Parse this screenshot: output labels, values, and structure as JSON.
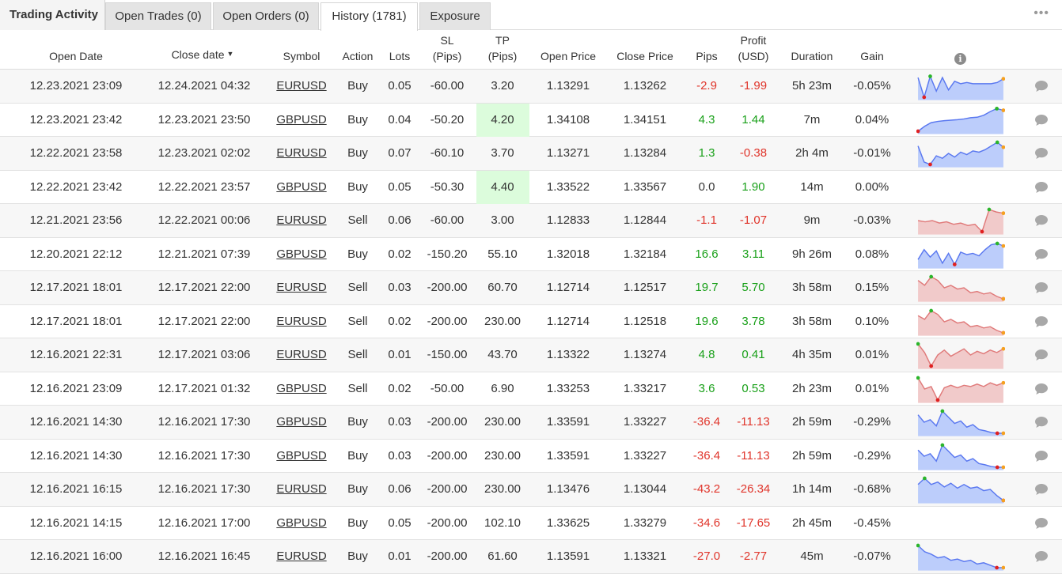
{
  "tabs": [
    {
      "label": "Trading Activity"
    },
    {
      "label": "Open Trades (0)"
    },
    {
      "label": "Open Orders (0)"
    },
    {
      "label": "History (1781)"
    },
    {
      "label": "Exposure"
    }
  ],
  "menu_icon": "more-dots-icon",
  "columns": {
    "open_date": "Open Date",
    "close_date": "Close date",
    "symbol": "Symbol",
    "action": "Action",
    "lots": "Lots",
    "sl": "SL",
    "sl_unit": "(Pips)",
    "tp": "TP",
    "tp_unit": "(Pips)",
    "open_price": "Open Price",
    "close_price": "Close Price",
    "pips": "Pips",
    "profit": "Profit",
    "profit_unit": "(USD)",
    "duration": "Duration",
    "gain": "Gain",
    "info": "i"
  },
  "colors": {
    "negative": "#e0352b",
    "positive": "#19a019",
    "tp_highlight": "#dcfcdc",
    "spark_buy": "#bccdfb",
    "spark_sell": "#f1caca"
  },
  "rows": [
    {
      "open": "12.23.2021 23:09",
      "close": "12.24.2021 04:32",
      "symbol": "EURUSD",
      "action": "Buy",
      "lots": "0.05",
      "sl": "-60.00",
      "tp": "3.20",
      "open_price": "1.13291",
      "close_price": "1.13262",
      "pips": "-2.9",
      "profit": "-1.99",
      "duration": "5h 23m",
      "gain": "-0.05%",
      "tp_hit": false,
      "spark": [
        0.85,
        0.05,
        0.9,
        0.3,
        0.85,
        0.35,
        0.7,
        0.6,
        0.65,
        0.6,
        0.6,
        0.6,
        0.6,
        0.65,
        0.8
      ]
    },
    {
      "open": "12.23.2021 23:42",
      "close": "12.23.2021 23:50",
      "symbol": "GBPUSD",
      "action": "Buy",
      "lots": "0.04",
      "sl": "-50.20",
      "tp": "4.20",
      "open_price": "1.34108",
      "close_price": "1.34151",
      "pips": "4.3",
      "profit": "1.44",
      "duration": "7m",
      "gain": "0.04%",
      "tp_hit": true,
      "spark": [
        0.05,
        0.25,
        0.4,
        0.45,
        0.48,
        0.5,
        0.52,
        0.55,
        0.6,
        0.62,
        0.7,
        0.85,
        0.97,
        0.9
      ]
    },
    {
      "open": "12.22.2021 23:58",
      "close": "12.23.2021 02:02",
      "symbol": "EURUSD",
      "action": "Buy",
      "lots": "0.07",
      "sl": "-60.10",
      "tp": "3.70",
      "open_price": "1.13271",
      "close_price": "1.13284",
      "pips": "1.3",
      "profit": "-0.38",
      "duration": "2h 4m",
      "gain": "-0.01%",
      "tp_hit": false,
      "spark": [
        0.8,
        0.15,
        0.05,
        0.4,
        0.3,
        0.5,
        0.35,
        0.55,
        0.45,
        0.6,
        0.55,
        0.65,
        0.8,
        0.95,
        0.75
      ]
    },
    {
      "open": "12.22.2021 23:42",
      "close": "12.22.2021 23:57",
      "symbol": "GBPUSD",
      "action": "Buy",
      "lots": "0.05",
      "sl": "-50.30",
      "tp": "4.40",
      "open_price": "1.33522",
      "close_price": "1.33567",
      "pips": "0.0",
      "profit": "1.90",
      "duration": "14m",
      "gain": "0.00%",
      "tp_hit": true,
      "spark": null
    },
    {
      "open": "12.21.2021 23:56",
      "close": "12.22.2021 00:06",
      "symbol": "EURUSD",
      "action": "Sell",
      "lots": "0.06",
      "sl": "-60.00",
      "tp": "3.00",
      "open_price": "1.12833",
      "close_price": "1.12844",
      "pips": "-1.1",
      "profit": "-1.07",
      "duration": "9m",
      "gain": "-0.03%",
      "tp_hit": false,
      "spark": [
        0.5,
        0.45,
        0.5,
        0.4,
        0.45,
        0.35,
        0.4,
        0.3,
        0.35,
        0.05,
        0.95,
        0.85,
        0.8
      ]
    },
    {
      "open": "12.20.2021 22:12",
      "close": "12.21.2021 07:39",
      "symbol": "GBPUSD",
      "action": "Buy",
      "lots": "0.02",
      "sl": "-150.20",
      "tp": "55.10",
      "open_price": "1.32018",
      "close_price": "1.32184",
      "pips": "16.6",
      "profit": "3.11",
      "duration": "9h 26m",
      "gain": "0.08%",
      "tp_hit": false,
      "spark": [
        0.3,
        0.7,
        0.4,
        0.65,
        0.15,
        0.55,
        0.1,
        0.6,
        0.5,
        0.55,
        0.45,
        0.7,
        0.9,
        0.95,
        0.85
      ]
    },
    {
      "open": "12.17.2021 18:01",
      "close": "12.17.2021 22:00",
      "symbol": "EURUSD",
      "action": "Sell",
      "lots": "0.03",
      "sl": "-200.00",
      "tp": "60.70",
      "open_price": "1.12714",
      "close_price": "1.12517",
      "pips": "19.7",
      "profit": "5.70",
      "duration": "3h 58m",
      "gain": "0.15%",
      "tp_hit": false,
      "spark": [
        0.8,
        0.6,
        0.95,
        0.8,
        0.5,
        0.6,
        0.45,
        0.5,
        0.3,
        0.35,
        0.25,
        0.3,
        0.15,
        0.05
      ]
    },
    {
      "open": "12.17.2021 18:01",
      "close": "12.17.2021 22:00",
      "symbol": "EURUSD",
      "action": "Sell",
      "lots": "0.02",
      "sl": "-200.00",
      "tp": "230.00",
      "open_price": "1.12714",
      "close_price": "1.12518",
      "pips": "19.6",
      "profit": "3.78",
      "duration": "3h 58m",
      "gain": "0.10%",
      "tp_hit": false,
      "spark": [
        0.75,
        0.6,
        0.95,
        0.8,
        0.5,
        0.6,
        0.45,
        0.5,
        0.3,
        0.35,
        0.25,
        0.3,
        0.15,
        0.05
      ]
    },
    {
      "open": "12.16.2021 22:31",
      "close": "12.17.2021 03:06",
      "symbol": "EURUSD",
      "action": "Sell",
      "lots": "0.01",
      "sl": "-150.00",
      "tp": "43.70",
      "open_price": "1.13322",
      "close_price": "1.13274",
      "pips": "4.8",
      "profit": "0.41",
      "duration": "4h 35m",
      "gain": "0.01%",
      "tp_hit": false,
      "spark": [
        0.95,
        0.6,
        0.05,
        0.5,
        0.7,
        0.45,
        0.6,
        0.75,
        0.5,
        0.65,
        0.55,
        0.7,
        0.6,
        0.75
      ]
    },
    {
      "open": "12.16.2021 23:09",
      "close": "12.17.2021 01:32",
      "symbol": "GBPUSD",
      "action": "Sell",
      "lots": "0.02",
      "sl": "-50.00",
      "tp": "6.90",
      "open_price": "1.33253",
      "close_price": "1.33217",
      "pips": "3.6",
      "profit": "0.53",
      "duration": "2h 23m",
      "gain": "0.01%",
      "tp_hit": false,
      "spark": [
        0.95,
        0.5,
        0.6,
        0.05,
        0.55,
        0.65,
        0.55,
        0.65,
        0.6,
        0.7,
        0.6,
        0.75,
        0.65,
        0.75
      ]
    },
    {
      "open": "12.16.2021 14:30",
      "close": "12.16.2021 17:30",
      "symbol": "GBPUSD",
      "action": "Buy",
      "lots": "0.03",
      "sl": "-200.00",
      "tp": "230.00",
      "open_price": "1.33591",
      "close_price": "1.33227",
      "pips": "-36.4",
      "profit": "-11.13",
      "duration": "2h 59m",
      "gain": "-0.29%",
      "tp_hit": false,
      "spark": [
        0.8,
        0.5,
        0.6,
        0.35,
        0.95,
        0.7,
        0.45,
        0.55,
        0.3,
        0.4,
        0.2,
        0.15,
        0.08,
        0.05,
        0.05
      ]
    },
    {
      "open": "12.16.2021 14:30",
      "close": "12.16.2021 17:30",
      "symbol": "GBPUSD",
      "action": "Buy",
      "lots": "0.03",
      "sl": "-200.00",
      "tp": "230.00",
      "open_price": "1.33591",
      "close_price": "1.33227",
      "pips": "-36.4",
      "profit": "-11.13",
      "duration": "2h 59m",
      "gain": "-0.29%",
      "tp_hit": false,
      "spark": [
        0.75,
        0.5,
        0.6,
        0.3,
        0.95,
        0.7,
        0.45,
        0.55,
        0.3,
        0.4,
        0.2,
        0.15,
        0.08,
        0.05,
        0.05
      ]
    },
    {
      "open": "12.16.2021 16:15",
      "close": "12.16.2021 17:30",
      "symbol": "EURUSD",
      "action": "Buy",
      "lots": "0.06",
      "sl": "-200.00",
      "tp": "230.00",
      "open_price": "1.13476",
      "close_price": "1.13044",
      "pips": "-43.2",
      "profit": "-26.34",
      "duration": "1h 14m",
      "gain": "-0.68%",
      "tp_hit": false,
      "spark": [
        0.7,
        0.95,
        0.7,
        0.8,
        0.6,
        0.75,
        0.55,
        0.7,
        0.55,
        0.6,
        0.45,
        0.5,
        0.25,
        0.05
      ]
    },
    {
      "open": "12.16.2021 14:15",
      "close": "12.16.2021 17:00",
      "symbol": "GBPUSD",
      "action": "Buy",
      "lots": "0.05",
      "sl": "-200.00",
      "tp": "102.10",
      "open_price": "1.33625",
      "close_price": "1.33279",
      "pips": "-34.6",
      "profit": "-17.65",
      "duration": "2h 45m",
      "gain": "-0.45%",
      "tp_hit": false,
      "spark": null
    },
    {
      "open": "12.16.2021 16:00",
      "close": "12.16.2021 16:45",
      "symbol": "EURUSD",
      "action": "Buy",
      "lots": "0.01",
      "sl": "-200.00",
      "tp": "61.60",
      "open_price": "1.13591",
      "close_price": "1.13321",
      "pips": "-27.0",
      "profit": "-2.77",
      "duration": "45m",
      "gain": "-0.07%",
      "tp_hit": false,
      "spark": [
        0.95,
        0.7,
        0.6,
        0.45,
        0.5,
        0.35,
        0.4,
        0.3,
        0.35,
        0.2,
        0.25,
        0.15,
        0.05,
        0.05
      ]
    }
  ]
}
